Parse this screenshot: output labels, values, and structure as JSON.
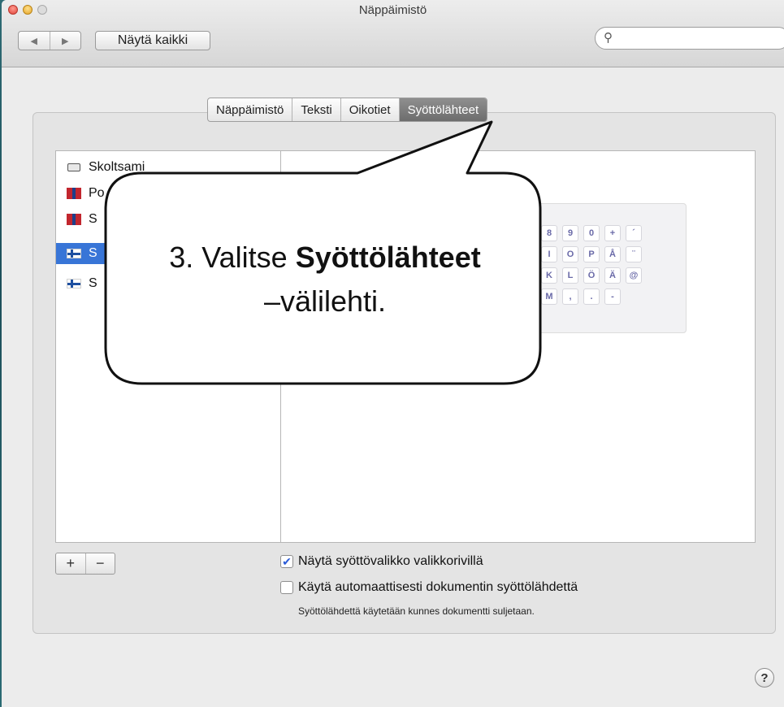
{
  "window": {
    "title": "Näppäimistö",
    "show_all_label": "Näytä kaikki",
    "search_placeholder": ""
  },
  "tabs": [
    {
      "label": "Näppäimistö",
      "selected": false
    },
    {
      "label": "Teksti",
      "selected": false
    },
    {
      "label": "Oikotiet",
      "selected": false
    },
    {
      "label": "Syöttölähteet",
      "selected": true
    }
  ],
  "input_sources": [
    {
      "label": "Skoltsami",
      "icon": "keyboard-icon"
    },
    {
      "label": "Po",
      "icon": "sami-flag-icon"
    },
    {
      "label": "S",
      "icon": "sami-pc-flag-icon"
    },
    {
      "label": "S",
      "icon": "finnish-sami-flag-icon",
      "selected": true
    },
    {
      "label": "S",
      "icon": "finnish-flag-icon"
    }
  ],
  "keyboard_preview": {
    "rows": [
      [
        "8",
        "9",
        "0",
        "+",
        "´"
      ],
      [
        "I",
        "O",
        "P",
        "Å",
        "¨"
      ],
      [
        "K",
        "L",
        "Ö",
        "Ä",
        "@"
      ],
      [
        "M",
        ",",
        ".",
        "-"
      ]
    ]
  },
  "list_buttons": {
    "add": "+",
    "remove": "−"
  },
  "options": {
    "show_menu_label": "Näytä syöttövalikko valikkorivillä",
    "show_menu_checked": true,
    "auto_switch_label": "Käytä automaattisesti dokumentin syöttölähdettä",
    "auto_switch_checked": false,
    "auto_switch_note": "Syöttölähdettä käytetään kunnes dokumentti suljetaan."
  },
  "help_label": "?",
  "callout": {
    "prefix": "3. Valitse ",
    "bold": "Syöttölähteet",
    "suffix": "–välilehti."
  }
}
